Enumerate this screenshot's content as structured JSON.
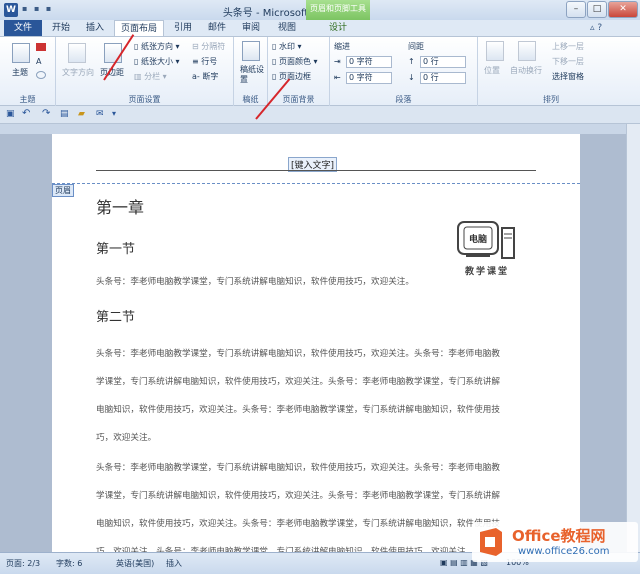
{
  "window": {
    "title": "头条号 - Microsoft Word",
    "contextual_tool": "页眉和页脚工具"
  },
  "tabs": [
    "文件",
    "开始",
    "插入",
    "页面布局",
    "引用",
    "邮件",
    "审阅",
    "视图",
    "设计"
  ],
  "ribbon": {
    "theme": {
      "label": "主题",
      "group": "主题"
    },
    "page_setup": {
      "text_direction": "文字方向",
      "margins": "页边距",
      "orientation": "纸张方向",
      "size": "纸张大小",
      "columns": "分栏",
      "breaks": "分隔符",
      "line_numbers": "行号",
      "hyphenation": "断字",
      "group": "页面设置"
    },
    "manuscript": {
      "label": "稿纸设置",
      "group": "稿纸"
    },
    "page_background": {
      "watermark": "水印",
      "page_color": "页面颜色",
      "page_border": "页面边框",
      "group": "页面背景"
    },
    "paragraph": {
      "indent_label": "缩进",
      "spacing_label": "间距",
      "indent_left": "0 字符",
      "indent_right": "0 字符",
      "space_before": "0 行",
      "space_after": "0 行",
      "group": "段落"
    },
    "arrange": {
      "position": "位置",
      "wrap": "自动换行",
      "bring_forward": "上移一层",
      "send_backward": "下移一层",
      "selection_pane": "选择窗格",
      "group": "排列"
    }
  },
  "document": {
    "header_placeholder": "[键入文字]",
    "header_tag": "页眉",
    "chapter": "第一章",
    "section1": "第一节",
    "section2": "第二节",
    "line1": "头条号：李老师电脑教学课堂，专门系统讲解电脑知识，软件使用技巧，欢迎关注。",
    "p1_lines": [
      "头条号：李老师电脑教学课堂，专门系统讲解电脑知识，软件使用技巧，欢迎关注。头条号：李老师电脑教",
      "学课堂，专门系统讲解电脑知识，软件使用技巧，欢迎关注。头条号：李老师电脑教学课堂，专门系统讲解",
      "电脑知识，软件使用技巧，欢迎关注。头条号：李老师电脑教学课堂，专门系统讲解电脑知识，软件使用技",
      "巧，欢迎关注。"
    ],
    "p2_lines": [
      "头条号：李老师电脑教学课堂，专门系统讲解电脑知识，软件使用技巧，欢迎关注。头条号：李老师电脑教",
      "学课堂，专门系统讲解电脑知识，软件使用技巧，欢迎关注。头条号：李老师电脑教学课堂，专门系统讲解",
      "电脑知识，软件使用技巧，欢迎关注。头条号：李老师电脑教学课堂，专门系统讲解电脑知识，软件使用技",
      "巧，欢迎关注。头条号：李老师电脑教学课堂，专门系统讲解电脑知识，软件使用技巧，欢迎关注"
    ],
    "logo_text": "电脑",
    "logo_caption": "教学课堂"
  },
  "status": {
    "page": "页面: 2/3",
    "words": "字数: 6",
    "language": "英语(美国)",
    "mode": "插入",
    "zoom": "100%"
  },
  "watermark": {
    "brand": "Office教程网",
    "url": "www.office26.com"
  }
}
